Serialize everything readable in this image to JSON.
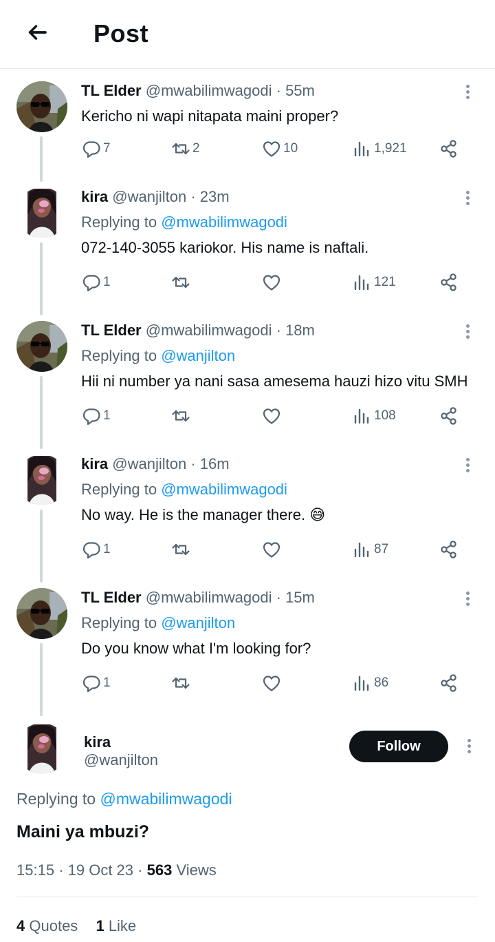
{
  "header": {
    "title": "Post"
  },
  "avatar_images": {
    "elder": "man-with-sunglasses-avatar",
    "kira": "woman-selfie-avatar"
  },
  "tweets": [
    {
      "name": "TL Elder",
      "handle": "@mwabilimwagodi",
      "time": "55m",
      "replying_prefix": "",
      "replying_to": "",
      "text": "Kericho ni wapi nitapata maini proper?",
      "replies": "7",
      "retweets": "2",
      "likes": "10",
      "views": "1,921"
    },
    {
      "name": "kira",
      "handle": "@wanjilton",
      "time": "23m",
      "replying_prefix": "Replying to",
      "replying_to": "@mwabilimwagodi",
      "text": "072-140-3055 kariokor. His name is naftali.",
      "replies": "1",
      "retweets": "",
      "likes": "",
      "views": "121"
    },
    {
      "name": "TL Elder",
      "handle": "@mwabilimwagodi",
      "time": "18m",
      "replying_prefix": "Replying to",
      "replying_to": "@wanjilton",
      "text": "Hii ni number ya nani sasa amesema hauzi hizo vitu SMH",
      "replies": "1",
      "retweets": "",
      "likes": "",
      "views": "108"
    },
    {
      "name": "kira",
      "handle": "@wanjilton",
      "time": "16m",
      "replying_prefix": "Replying to",
      "replying_to": "@mwabilimwagodi",
      "text": "No way. He is the manager there. 😅",
      "replies": "1",
      "retweets": "",
      "likes": "",
      "views": "87"
    },
    {
      "name": "TL Elder",
      "handle": "@mwabilimwagodi",
      "time": "15m",
      "replying_prefix": "Replying to",
      "replying_to": "@wanjilton",
      "text": "Do you know what I'm looking for?",
      "replies": "1",
      "retweets": "",
      "likes": "",
      "views": "86"
    }
  ],
  "main": {
    "name": "kira",
    "handle": "@wanjilton",
    "follow_label": "Follow",
    "replying_prefix": "Replying to",
    "replying_to": "@mwabilimwagodi",
    "text": "Maini ya mbuzi?",
    "time": "15:15",
    "date": "19 Oct 23",
    "views_count": "563",
    "views_label": "Views",
    "quotes_count": "4",
    "quotes_label": "Quotes",
    "likes_count": "1",
    "likes_label": "Like"
  }
}
